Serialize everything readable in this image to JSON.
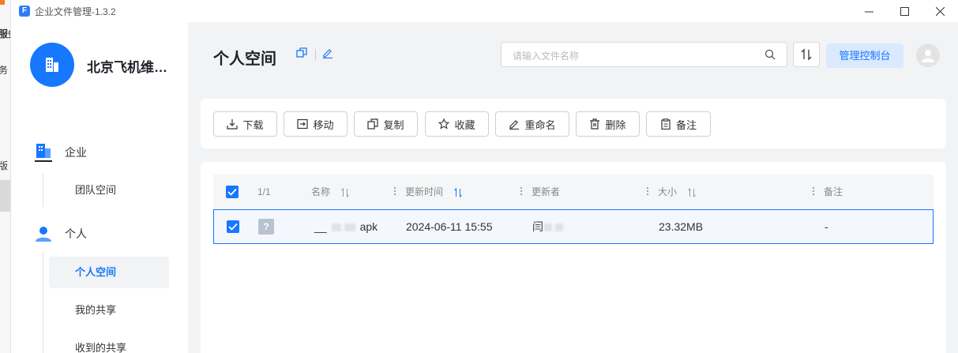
{
  "window": {
    "title": "企业文件管理-1.3.2",
    "app_icon_letter": "F"
  },
  "background_window": {
    "texts": [
      "服务",
      "务",
      "版"
    ]
  },
  "sidebar": {
    "org_name": "北京飞机维修…",
    "sections": [
      {
        "label": "企业",
        "icon": "building-icon",
        "items": [
          {
            "label": "团队空间",
            "active": false
          }
        ]
      },
      {
        "label": "个人",
        "icon": "user-icon",
        "items": [
          {
            "label": "个人空间",
            "active": true
          },
          {
            "label": "我的共享",
            "active": false
          },
          {
            "label": "收到的共享",
            "active": false
          }
        ]
      }
    ]
  },
  "header": {
    "title": "个人空间",
    "search_placeholder": "请输入文件名称",
    "manage_button": "管理控制台"
  },
  "toolbar": {
    "buttons": [
      {
        "label": "下载",
        "icon": "download-icon"
      },
      {
        "label": "移动",
        "icon": "move-icon"
      },
      {
        "label": "复制",
        "icon": "copy-icon"
      },
      {
        "label": "收藏",
        "icon": "star-icon"
      },
      {
        "label": "重命名",
        "icon": "edit-icon"
      },
      {
        "label": "删除",
        "icon": "trash-icon"
      },
      {
        "label": "备注",
        "icon": "clipboard-icon"
      }
    ]
  },
  "table": {
    "selection_count": "1/1",
    "columns": {
      "name": "名称",
      "updated": "更新时间",
      "updater": "更新者",
      "size": "大小",
      "note": "备注"
    },
    "rows": [
      {
        "checked": true,
        "name_prefix": "__",
        "name_suffix": "apk",
        "updated": "2024-06-11 15:55",
        "updater_prefix": "闫",
        "size": "23.32MB",
        "note": "-"
      }
    ]
  },
  "colors": {
    "accent": "#1677ff",
    "accent_light": "#dbe9ff"
  }
}
